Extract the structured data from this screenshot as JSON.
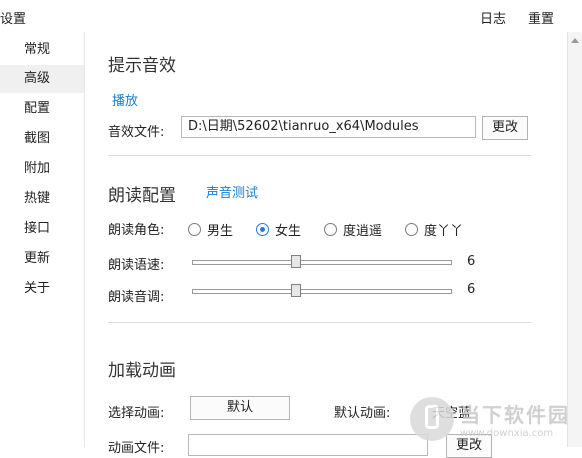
{
  "window": {
    "title": "设置",
    "log_label": "日志",
    "reset_label": "重置"
  },
  "sidebar": {
    "items": [
      {
        "label": "常规"
      },
      {
        "label": "高级",
        "active": true
      },
      {
        "label": "配置"
      },
      {
        "label": "截图"
      },
      {
        "label": "附加"
      },
      {
        "label": "热键"
      },
      {
        "label": "接口"
      },
      {
        "label": "更新"
      },
      {
        "label": "关于"
      }
    ]
  },
  "sound": {
    "title": "提示音效",
    "play_link": "播放",
    "file_label": "音效文件:",
    "file_value": "D:\\日期\\52602\\tianruo_x64\\Modules",
    "change_button": "更改"
  },
  "reading": {
    "title": "朗读配置",
    "test_link": "声音测试",
    "role_label": "朗读角色:",
    "roles": [
      {
        "label": "男生",
        "checked": false
      },
      {
        "label": "女生",
        "checked": true
      },
      {
        "label": "度逍遥",
        "checked": false
      },
      {
        "label": "度丫丫",
        "checked": false
      }
    ],
    "speed_label": "朗读语速:",
    "speed_value": "6",
    "speed_fraction": 0.4,
    "pitch_label": "朗读音调:",
    "pitch_value": "6",
    "pitch_fraction": 0.4
  },
  "animation": {
    "title": "加载动画",
    "select_label": "选择动画:",
    "select_button": "默认",
    "default_label": "默认动画:",
    "default_value": "天空蓝",
    "file_label": "动画文件:",
    "file_value": "",
    "change_button": "更改"
  },
  "watermark": {
    "brand": "当下软件园",
    "url": "www.downxia.com"
  }
}
